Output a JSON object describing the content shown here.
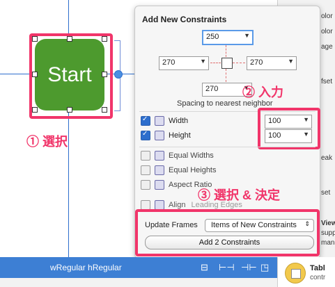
{
  "canvas": {
    "start_button_label": "Start",
    "step1_label": "① 選択",
    "step2_label": "② 入力",
    "step3_label": "③ 選択 & 決定"
  },
  "popover": {
    "title": "Add New Constraints",
    "top_value": "250",
    "left_value": "270",
    "right_value": "270",
    "bottom_value": "270",
    "spacing_text": "Spacing to nearest neighbor",
    "options": [
      {
        "label": "Width",
        "checked": true,
        "value": "100"
      },
      {
        "label": "Height",
        "checked": true,
        "value": "100"
      },
      {
        "label": "Equal Widths",
        "checked": false
      },
      {
        "label": "Equal Heights",
        "checked": false
      },
      {
        "label": "Aspect Ratio",
        "checked": false
      },
      {
        "label": "Align",
        "checked": false,
        "value": "Leading Edges"
      }
    ],
    "update_frames_label": "Update Frames",
    "update_frames_value": "Items of New Constraints",
    "add_button_label": "Add 2 Constraints"
  },
  "bottom_bar": {
    "size_class": "wRegular hRegular"
  },
  "right_panel": {
    "fragments": [
      "olor",
      "olor",
      "age",
      "fset",
      "eak",
      "set",
      "View",
      "supp",
      "mana"
    ],
    "table_item": "Tabl",
    "table_item_sub": "contr"
  },
  "colors": {
    "accent": "#f1356a",
    "start_button": "#4d9a2e",
    "bar": "#3d7fd4"
  }
}
